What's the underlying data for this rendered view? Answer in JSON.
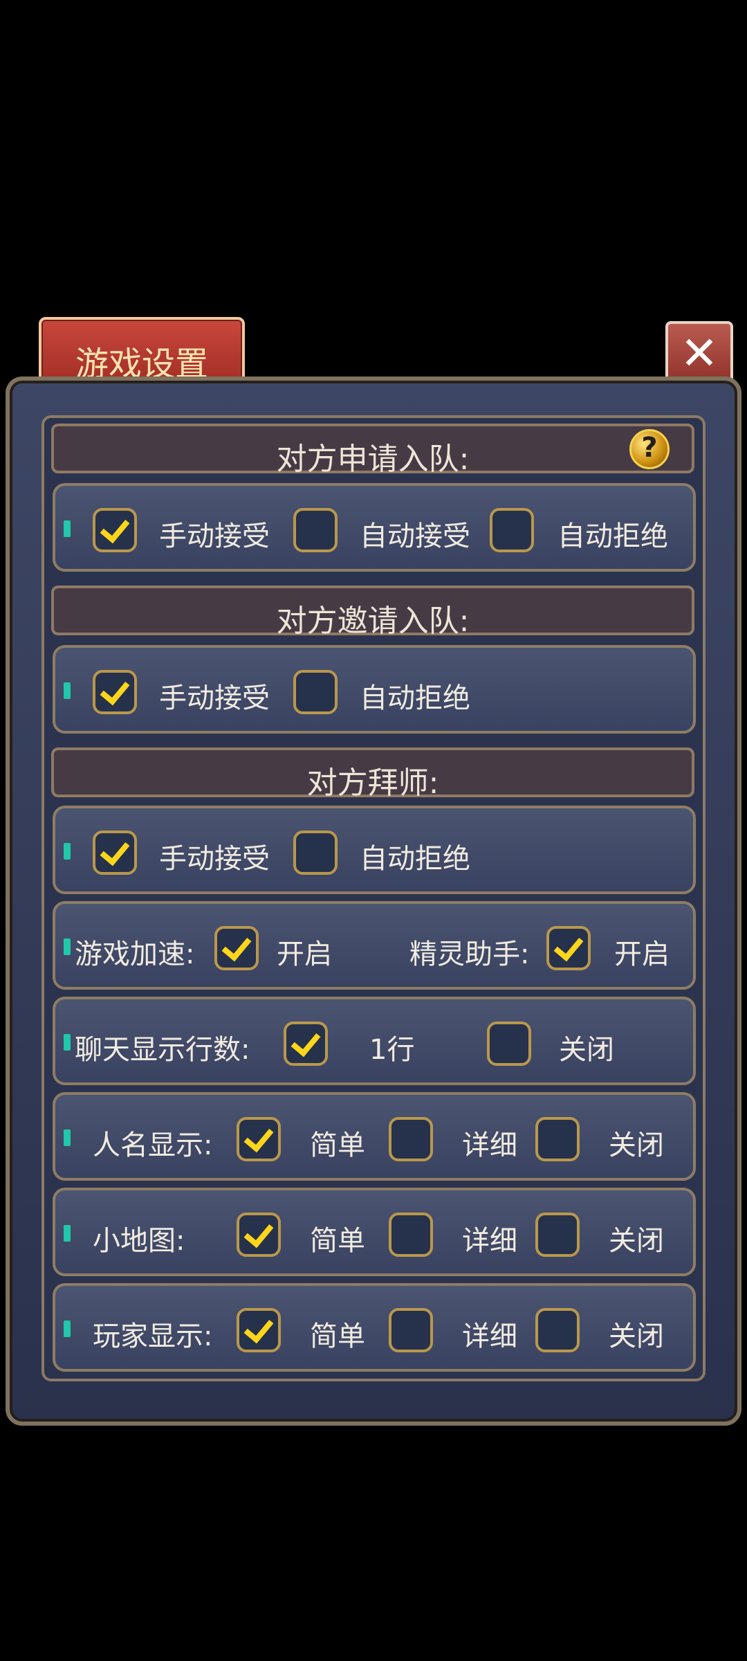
{
  "title": "游戏设置",
  "close_icon": "close-icon",
  "sections": [
    {
      "title": "对方申请入队:",
      "help": "?"
    },
    {
      "title": "对方邀请入队:"
    },
    {
      "title": "对方拜师:"
    }
  ],
  "rows": {
    "apply": {
      "opt1": "手动接受",
      "opt2": "自动接受",
      "opt3": "自动拒绝"
    },
    "invite": {
      "opt1": "手动接受",
      "opt2": "自动拒绝"
    },
    "mentor": {
      "opt1": "手动接受",
      "opt2": "自动拒绝"
    },
    "speed": {
      "label": "游戏加速:",
      "value": "开启",
      "label2": "精灵助手:",
      "value2": "开启"
    },
    "chat": {
      "label": "聊天显示行数:",
      "opt1": "1行",
      "opt2": "关闭"
    },
    "name": {
      "label": "人名显示:",
      "opt1": "简单",
      "opt2": "详细",
      "opt3": "关闭"
    },
    "minimap": {
      "label": "小地图:",
      "opt1": "简单",
      "opt2": "详细",
      "opt3": "关闭"
    },
    "player": {
      "label": "玩家显示:",
      "opt1": "简单",
      "opt2": "详细",
      "opt3": "关闭"
    }
  },
  "colors": {
    "accent": "#ffd61a",
    "panel": "#2b334e",
    "border": "#8e7d64"
  }
}
